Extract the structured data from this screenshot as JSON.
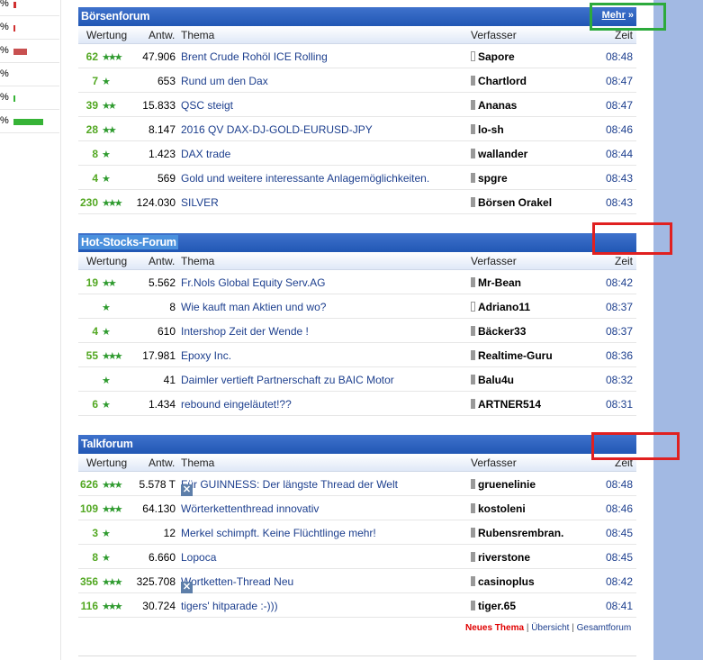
{
  "left_strip": [
    {
      "pct": "%",
      "bar_color": "#d03030",
      "bar_fraction": 0.06
    },
    {
      "pct": "%",
      "bar_color": "#d03030",
      "bar_fraction": 0.03
    },
    {
      "pct": "%",
      "bar_color": "#c85050",
      "bar_fraction": 0.3
    },
    {
      "pct": "%",
      "bar_color": "#d03030",
      "bar_fraction": 0.0
    },
    {
      "pct": "%",
      "bar_color": "#36b336",
      "bar_fraction": 0.04
    },
    {
      "pct": "%",
      "bar_color": "#36b336",
      "bar_fraction": 0.66
    }
  ],
  "columns": {
    "rating": "Wertung",
    "answers": "Antw.",
    "topic": "Thema",
    "author": "Verfasser",
    "time": "Zeit"
  },
  "forums": [
    {
      "title": "Börsenforum",
      "more": "Mehr",
      "rows": [
        {
          "rating": "62",
          "stars": "★★★",
          "answers": "47.906",
          "icon": "",
          "topic": "Brent Crude Rohöl ICE Rolling",
          "author": "Sapore",
          "author_box": "empty",
          "time": "08:48"
        },
        {
          "rating": "7",
          "stars": "★",
          "answers": "653",
          "icon": "",
          "topic": "Rund um den Dax",
          "author": "Chartlord",
          "author_box": "full",
          "time": "08:47"
        },
        {
          "rating": "39",
          "stars": "★★",
          "answers": "15.833",
          "icon": "",
          "topic": "QSC steigt",
          "author": "Ananas",
          "author_box": "full",
          "time": "08:47"
        },
        {
          "rating": "28",
          "stars": "★★",
          "answers": "8.147",
          "icon": "",
          "topic": "2016 QV DAX-DJ-GOLD-EURUSD-JPY",
          "author": "lo-sh",
          "author_box": "full",
          "time": "08:46"
        },
        {
          "rating": "8",
          "stars": "★",
          "answers": "1.423",
          "icon": "",
          "topic": "DAX trade",
          "author": "wallander",
          "author_box": "full",
          "time": "08:44"
        },
        {
          "rating": "4",
          "stars": "★",
          "answers": "569",
          "icon": "",
          "topic": "Gold und weitere interessante Anlagemöglichkeiten.",
          "author": "spgre",
          "author_box": "full",
          "time": "08:43"
        },
        {
          "rating": "230",
          "stars": "★★★",
          "answers": "124.030",
          "icon": "",
          "topic": "SILVER",
          "author": "Börsen Orakel",
          "author_box": "full",
          "time": "08:43"
        }
      ]
    },
    {
      "title": "Hot-Stocks-Forum",
      "more": "",
      "rows": [
        {
          "rating": "19",
          "stars": "★★",
          "answers": "5.562",
          "icon": "",
          "topic": "Fr.Nols Global Equity Serv.AG",
          "author": "Mr-Bean",
          "author_box": "full",
          "time": "08:42"
        },
        {
          "rating": "",
          "stars": "★",
          "answers": "8",
          "icon": "",
          "topic": "Wie kauft man Aktien und wo?",
          "author": "Adriano11",
          "author_box": "empty",
          "time": "08:37"
        },
        {
          "rating": "4",
          "stars": "★",
          "answers": "610",
          "icon": "",
          "topic": "Intershop Zeit der Wende !",
          "author": "Bäcker33",
          "author_box": "full",
          "time": "08:37"
        },
        {
          "rating": "55",
          "stars": "★★★",
          "answers": "17.981",
          "icon": "",
          "topic": "Epoxy Inc.",
          "author": "Realtime-Guru",
          "author_box": "full",
          "time": "08:36"
        },
        {
          "rating": "",
          "stars": "★",
          "answers": "41",
          "icon": "",
          "topic": "Daimler vertieft Partnerschaft zu BAIC Motor",
          "author": "Balu4u",
          "author_box": "full",
          "time": "08:32"
        },
        {
          "rating": "6",
          "stars": "★",
          "answers": "1.434",
          "icon": "",
          "topic": "rebound eingeläutet!??",
          "author": "ARTNER514",
          "author_box": "full",
          "time": "08:31"
        }
      ]
    },
    {
      "title": "Talkforum",
      "more": "",
      "rows": [
        {
          "rating": "626",
          "stars": "★★★",
          "answers": "5.578 T",
          "icon": "x",
          "topic": "Für GUINNESS: Der längste Thread der Welt",
          "author": "gruenelinie",
          "author_box": "full",
          "time": "08:48"
        },
        {
          "rating": "109",
          "stars": "★★★",
          "answers": "64.130",
          "icon": "",
          "topic": "Wörterkettenthread innovativ",
          "author": "kostoleni",
          "author_box": "full",
          "time": "08:46"
        },
        {
          "rating": "3",
          "stars": "★",
          "answers": "12",
          "icon": "",
          "topic": "Merkel schimpft. Keine Flüchtlinge mehr!",
          "author": "Rubensrembran.",
          "author_box": "full",
          "time": "08:45"
        },
        {
          "rating": "8",
          "stars": "★",
          "answers": "6.660",
          "icon": "",
          "topic": "Lopoca",
          "author": "riverstone",
          "author_box": "full",
          "time": "08:45"
        },
        {
          "rating": "356",
          "stars": "★★★",
          "answers": "325.708",
          "icon": "x",
          "topic": "Wortketten-Thread Neu",
          "author": "casinoplus",
          "author_box": "full",
          "time": "08:42"
        },
        {
          "rating": "116",
          "stars": "★★★",
          "answers": "30.724",
          "icon": "",
          "topic": "tigers' hitparade :-)))",
          "author": "tiger.65",
          "author_box": "full",
          "time": "08:41"
        }
      ]
    }
  ],
  "footer": {
    "new_topic": "Neues Thema",
    "sep": "|",
    "overview": "Übersicht",
    "all_forums": "Gesamtforum"
  },
  "colors": {
    "header": "#2a5fbd",
    "accent_green": "#53a823",
    "link": "#1d3f8e",
    "red_annotation": "#e02020",
    "green_annotation": "#2caa3c",
    "side_band": "#a2b9e3"
  }
}
